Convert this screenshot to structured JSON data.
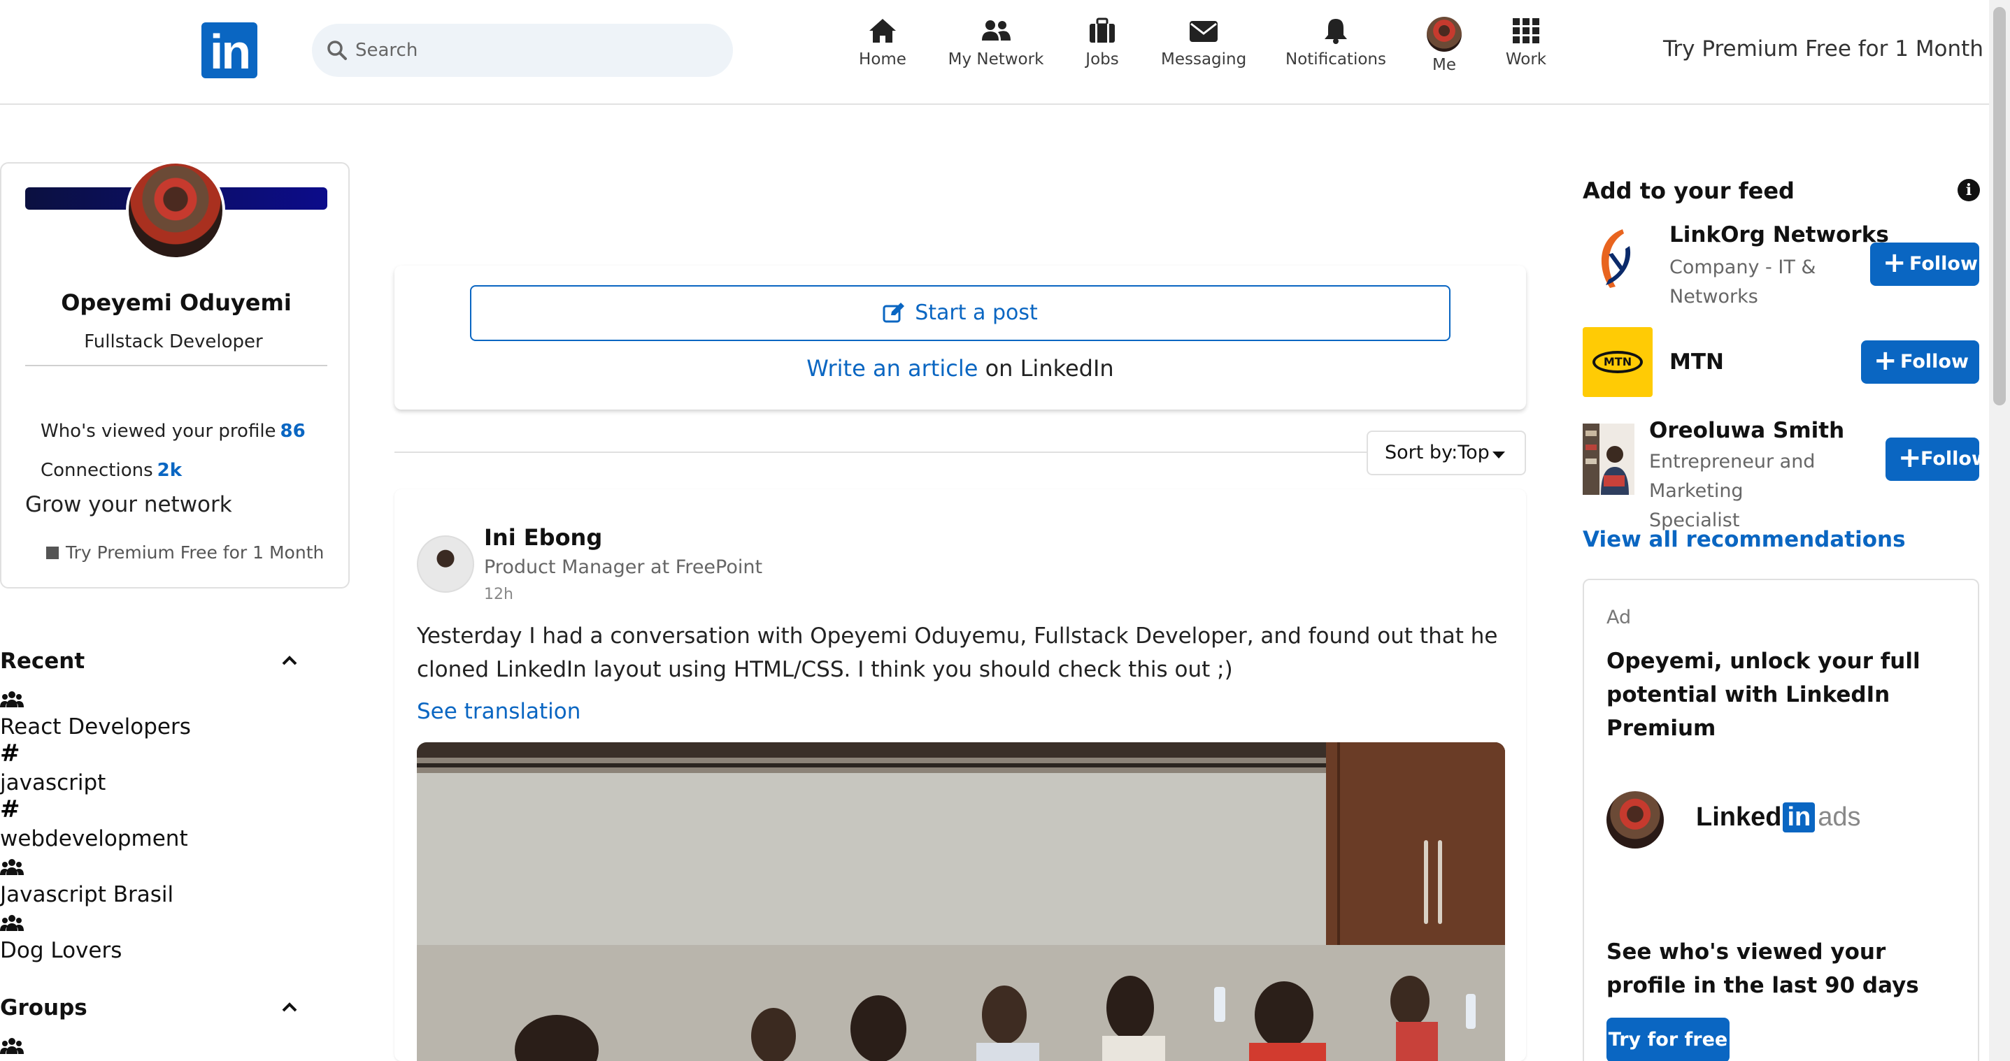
{
  "header": {
    "logo_text": "in",
    "search_placeholder": "Search",
    "nav": [
      {
        "label": "Home",
        "icon": "home-icon"
      },
      {
        "label": "My Network",
        "icon": "network-icon"
      },
      {
        "label": "Jobs",
        "icon": "briefcase-icon"
      },
      {
        "label": "Messaging",
        "icon": "envelope-icon"
      },
      {
        "label": "Notifications",
        "icon": "bell-icon"
      },
      {
        "label": "Me",
        "icon": "avatar"
      },
      {
        "label": "Work",
        "icon": "grid-icon"
      }
    ],
    "premium_link": "Try Premium Free for 1 Month"
  },
  "profile": {
    "name": "Opeyemi Oduyemi",
    "headline": "Fullstack Developer",
    "views_label": "Who's viewed your profile",
    "views_value": "86",
    "connections_label": "Connections",
    "connections_value": "2k",
    "grow_label": "Grow your network",
    "premium_label": "Try Premium Free for 1 Month"
  },
  "recent": {
    "title": "Recent",
    "items": [
      {
        "icon": "group-icon",
        "label": "React Developers"
      },
      {
        "icon": "hashtag-icon",
        "label": "javascript"
      },
      {
        "icon": "hashtag-icon",
        "label": "webdevelopment"
      },
      {
        "icon": "group-icon",
        "label": "Javascript Brasil"
      },
      {
        "icon": "group-icon",
        "label": "Dog Lovers"
      }
    ]
  },
  "groups": {
    "title": "Groups"
  },
  "compose": {
    "start_post": "Start a post",
    "write_link": "Write an article",
    "write_suffix": "on LinkedIn"
  },
  "sort": {
    "label": "Sort by:",
    "value": "Top"
  },
  "post": {
    "author": "Ini Ebong",
    "role": "Product Manager at FreePoint",
    "time": "12h",
    "text": "Yesterday I had a conversation with Opeyemi Oduyemu, Fullstack Developer, and found out that he cloned LinkedIn layout using HTML/CSS. I think you should check this out ;)",
    "see_translation": "See translation"
  },
  "feed": {
    "title": "Add to your feed",
    "recommendations": [
      {
        "name": "LinkOrg Networks",
        "subtitle": "Company - IT & Networks",
        "follow": "Follow"
      },
      {
        "name": "MTN",
        "subtitle": "",
        "logo_text": "MTN",
        "follow": "Follow"
      },
      {
        "name": "Oreoluwa Smith",
        "subtitle": "Entrepreneur and Marketing Specialist",
        "follow": "Follow"
      }
    ],
    "view_all": "View all recommendations"
  },
  "ad": {
    "label": "Ad",
    "headline": "Opeyemi, unlock your full potential with LinkedIn Premium",
    "logo_word": "Linked",
    "logo_in": "in",
    "logo_ads": "ads",
    "bottom_text": "See who's viewed your profile in the last 90 days",
    "cta": "Try for free"
  },
  "colors": {
    "brand": "#0a66c2",
    "text": "#1d2226",
    "muted": "#666666",
    "mtn_yellow": "#ffcb05"
  }
}
